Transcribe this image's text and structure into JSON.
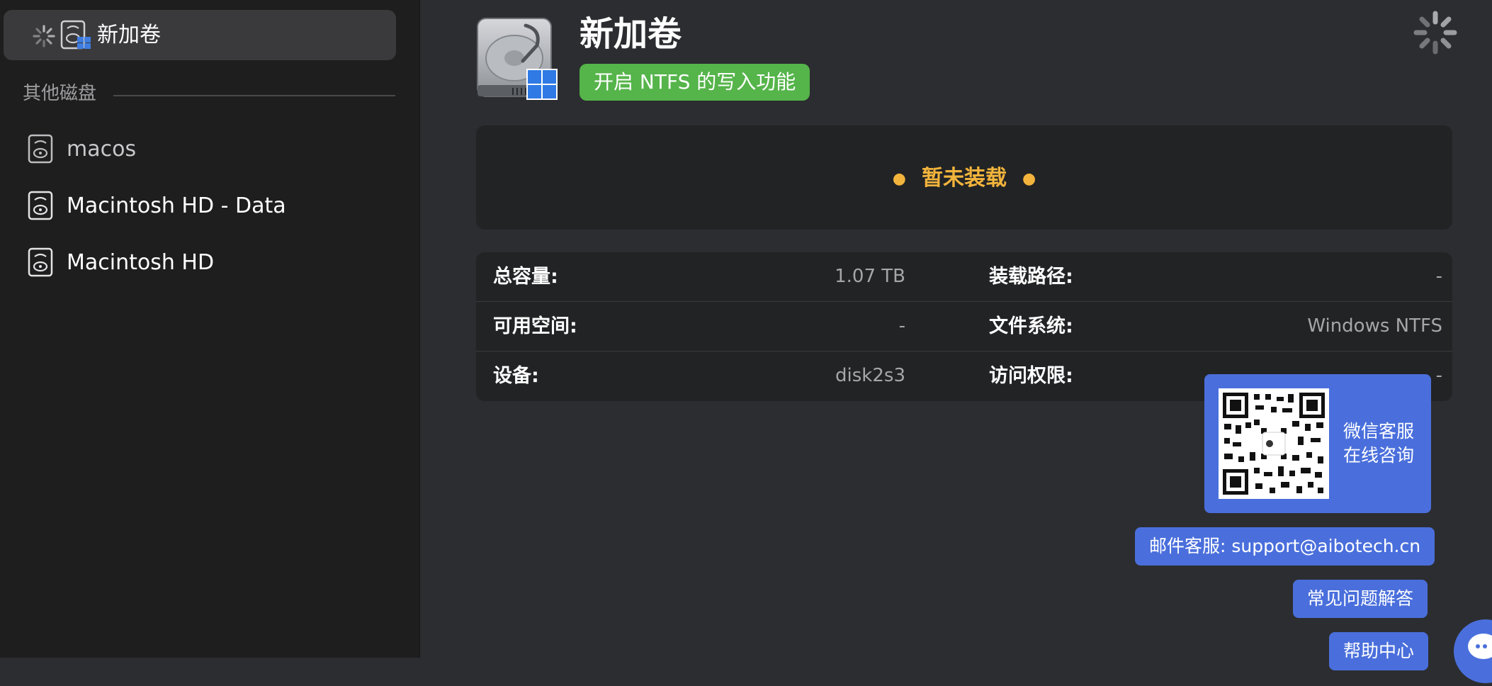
{
  "sidebar": {
    "selected": {
      "label": "新加卷"
    },
    "section_title": "其他磁盘",
    "disks": [
      {
        "name": "macos"
      },
      {
        "name": "Macintosh HD - Data"
      },
      {
        "name": "Macintosh HD"
      }
    ]
  },
  "main": {
    "title": "新加卷",
    "ntfs_button": "开启 NTFS 的写入功能",
    "mount_status": "暂未装载",
    "info": {
      "total_label": "总容量:",
      "total_value": "1.07 TB",
      "mount_path_label": "装载路径:",
      "mount_path_value": "-",
      "free_label": "可用空间:",
      "free_value": "-",
      "fs_label": "文件系统:",
      "fs_value": "Windows NTFS",
      "device_label": "设备:",
      "device_value": "disk2s3",
      "access_label": "访问权限:",
      "access_value": "-"
    }
  },
  "support": {
    "wechat_line1": "微信客服",
    "wechat_line2": "在线咨询",
    "email": "邮件客服: support@aibotech.cn",
    "faq": "常见问题解答",
    "help": "帮助中心"
  },
  "colors": {
    "sidebar_bg": "#1e1e1f",
    "main_bg": "#2c2d30",
    "card_bg": "#222325",
    "accent_green": "#55b44a",
    "accent_blue": "#4a6fdc",
    "status_amber": "#f2b43c"
  },
  "icons": {
    "spinner": "spinner-icon",
    "disk": "disk-icon",
    "windows": "windows-logo-icon",
    "qr": "qr-code-icon",
    "chat": "chat-icon"
  }
}
